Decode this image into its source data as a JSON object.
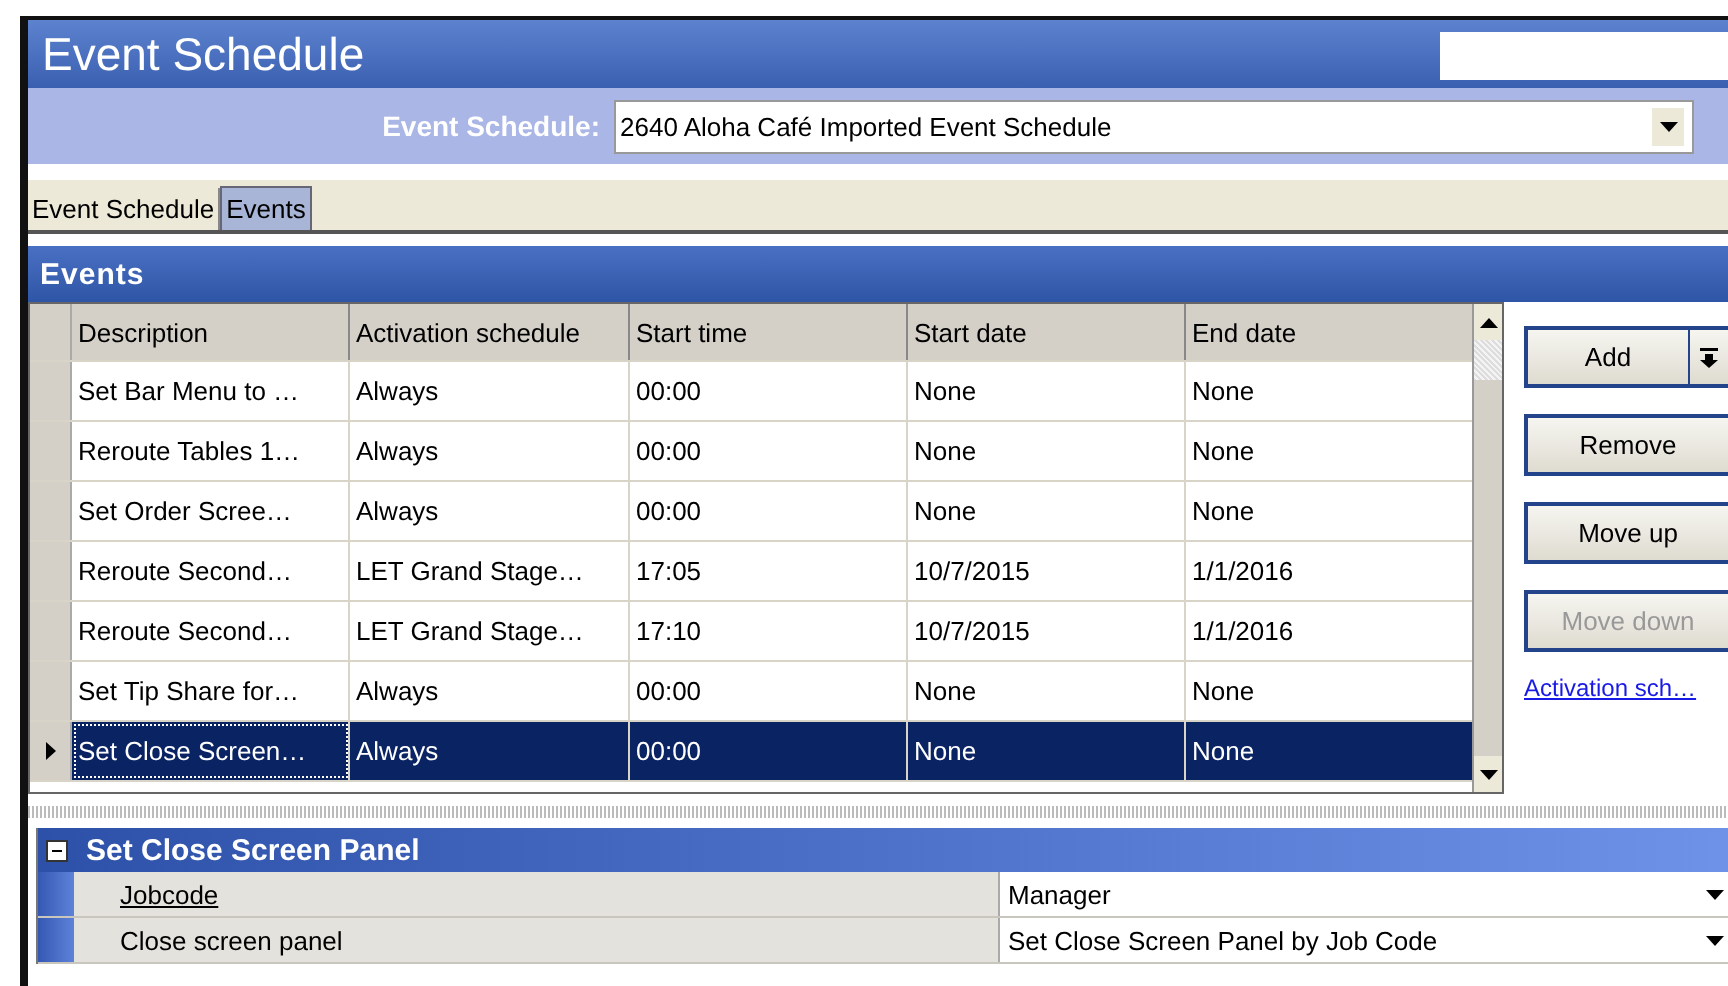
{
  "window": {
    "title": "Event Schedule"
  },
  "schedule_selector": {
    "label": "Event Schedule:",
    "value": "2640 Aloha Café Imported Event Schedule"
  },
  "tabs": [
    {
      "label": "Event Schedule",
      "selected": false
    },
    {
      "label": "Events",
      "selected": true
    }
  ],
  "section": {
    "title": "Events"
  },
  "table": {
    "columns": [
      "Description",
      "Activation schedule",
      "Start time",
      "Start date",
      "End date"
    ],
    "rows": [
      {
        "cells": [
          "Set Bar Menu to …",
          "Always",
          "00:00",
          "None",
          "None"
        ],
        "selected": false
      },
      {
        "cells": [
          "Reroute Tables 1…",
          "Always",
          "00:00",
          "None",
          "None"
        ],
        "selected": false
      },
      {
        "cells": [
          "Set Order Scree…",
          "Always",
          "00:00",
          "None",
          "None"
        ],
        "selected": false
      },
      {
        "cells": [
          "Reroute Second…",
          "LET Grand Stage…",
          "17:05",
          "10/7/2015",
          "1/1/2016"
        ],
        "selected": false
      },
      {
        "cells": [
          "Reroute Second…",
          "LET Grand Stage…",
          "17:10",
          "10/7/2015",
          "1/1/2016"
        ],
        "selected": false
      },
      {
        "cells": [
          "Set Tip Share for…",
          "Always",
          "00:00",
          "None",
          "None"
        ],
        "selected": false
      },
      {
        "cells": [
          "Set Close Screen…",
          "Always",
          "00:00",
          "None",
          "None"
        ],
        "selected": true
      }
    ]
  },
  "buttons": [
    {
      "label": "Add",
      "kind": "split",
      "disabled": false
    },
    {
      "label": "Remove",
      "kind": "plain",
      "disabled": false
    },
    {
      "label": "Move up",
      "kind": "plain",
      "disabled": false
    },
    {
      "label": "Move down",
      "kind": "plain",
      "disabled": true
    }
  ],
  "link": "Activation sch…",
  "properties": {
    "title": "Set Close Screen Panel",
    "expanded": true,
    "rows": [
      {
        "label": "Jobcode",
        "value": "Manager",
        "underlined": true
      },
      {
        "label": "Close screen panel",
        "value": "Set Close Screen Panel by Job Code",
        "underlined": false
      }
    ]
  }
}
